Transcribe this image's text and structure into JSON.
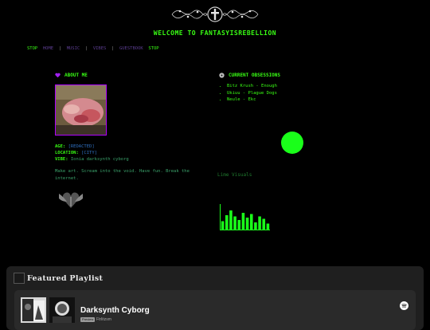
{
  "header": {
    "welcome": "WELCOME TO FANTASYISREBELLION"
  },
  "nav": {
    "left_bracket": "STOP",
    "links": [
      "HOME",
      "MUSIC",
      "VIBES",
      "GUESTBOOK"
    ],
    "separator": "|",
    "right_bracket": "STOP"
  },
  "about": {
    "icon": "purple-heart-icon",
    "title": "ABOUT ME",
    "age_label": "AGE:",
    "age_value": "[REDACTED]",
    "location_label": "LOCATION:",
    "location_value": "[CITY]",
    "vibe_label": "VIBE:",
    "vibe_value": "Ionia darksynth cyborg",
    "bio": "Make art. Scream into the void. Have fun. Break the internet."
  },
  "obsessions": {
    "icon": "disc-icon",
    "title": "CURRENT OBSESSIONS",
    "items": [
      "Bitz Krush - Enough",
      "Ukiuu - Plague Dogs",
      "Neule - Ekc"
    ],
    "caption": "Lime Visuals"
  },
  "playlist_card": {
    "section_title": "Featured Playlist",
    "name": "Darksynth Cyborg",
    "badge": "Preview",
    "sub": "Ftrlitzsm",
    "logo": "spotify-icon"
  },
  "colors": {
    "accent": "#39ff14",
    "purple": "#b000ff",
    "card_bg": "#1f1f1f"
  },
  "equalizer": {
    "levels": [
      0.35,
      0.6,
      0.8,
      0.55,
      0.4,
      0.7,
      0.5,
      0.65,
      0.3,
      0.55,
      0.45,
      0.25
    ]
  }
}
